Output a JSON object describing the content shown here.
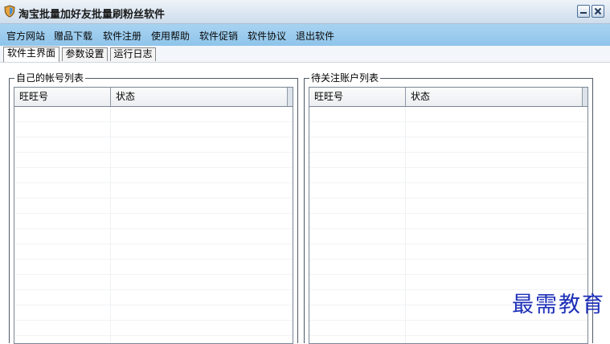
{
  "window": {
    "title": "淘宝批量加好友批量刷粉丝软件",
    "icon": "shield-app-icon",
    "controls": [
      "minimize-icon",
      "close-icon"
    ]
  },
  "menu": {
    "items": [
      "官方网站",
      "赠品下载",
      "软件注册",
      "使用帮助",
      "软件促销",
      "软件协议",
      "退出软件"
    ]
  },
  "tabs": [
    {
      "label": "软件主界面",
      "active": true
    },
    {
      "label": "参数设置",
      "active": false
    },
    {
      "label": "运行日志",
      "active": false
    }
  ],
  "left_panel": {
    "title": "自己的帐号列表",
    "columns": [
      "旺旺号",
      "状态"
    ],
    "rows": []
  },
  "right_panel": {
    "title": "待关注账户列表",
    "columns": [
      "旺旺号",
      "状态"
    ],
    "rows": []
  },
  "watermark": "最需教育",
  "colors": {
    "menubar": "#9ccbee",
    "titlebar": "#dce7f2",
    "watermark": "#1d2fb8"
  }
}
